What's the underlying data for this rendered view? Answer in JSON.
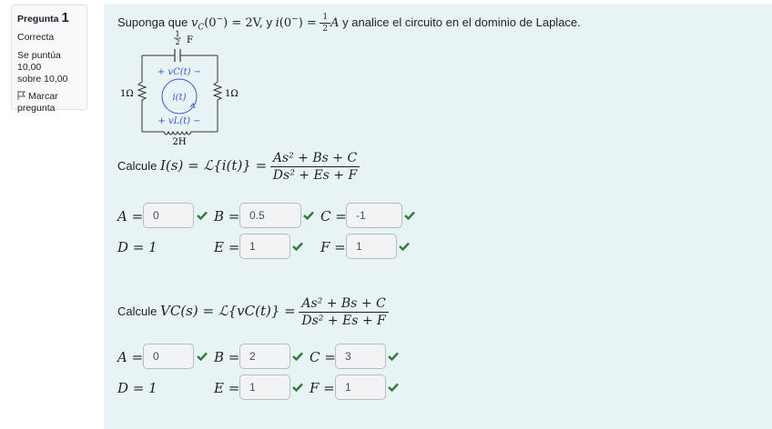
{
  "info": {
    "question_label": "Pregunta",
    "question_number": "1",
    "state": "Correcta",
    "score_line1": "Se puntúa 10,00",
    "score_line2": "sobre 10,00",
    "flag_line1": "Marcar",
    "flag_line2": "pregunta"
  },
  "question": {
    "intro_prefix": "Suponga que",
    "intro_vc": "v",
    "intro_vc_sub": "C",
    "intro_vc_arg": "(0",
    "intro_vc_sup": "−",
    "intro_vc_val": ") = 2V,",
    "intro_y": "y",
    "intro_i": "i",
    "intro_i_arg": "(0",
    "intro_i_sup": "−",
    "intro_i_eq": ") =",
    "intro_frac_num": "1",
    "intro_frac_den": "2",
    "intro_unit": "A",
    "intro_suffix": "y analice el circuito en el dominio de Laplace."
  },
  "circuit": {
    "cap_label_num": "1",
    "cap_label_den": "2",
    "cap_label_unit": "F",
    "r_left": "1Ω",
    "r_right": "1Ω",
    "vc_label": "+ vC(t) −",
    "it_label": "i(t)",
    "vl_label": "+ vL(t) −",
    "ind_label": "2H"
  },
  "part1": {
    "prefix": "Calcule",
    "lhs": "I(s) = ℒ{i(t)} =",
    "num": "As² + Bs + C",
    "den": "Ds² + Es + F",
    "labels": {
      "A": "A =",
      "B": "B =",
      "C": "C =",
      "D": "D = 1",
      "E": "E =",
      "F": "F ="
    },
    "values": {
      "A": "0",
      "B": "0.5",
      "C": "-1",
      "E": "1",
      "F": "1"
    }
  },
  "part2": {
    "prefix": "Calcule",
    "lhs": "VC(s) = ℒ{vC(t)} =",
    "num": "As² + Bs + C",
    "den": "Ds² + Es + F",
    "labels": {
      "A": "A =",
      "B": "B =",
      "C": "C =",
      "D": "D = 1",
      "E": "E =",
      "F": "F ="
    },
    "values": {
      "A": "0",
      "B": "2",
      "C": "3",
      "E": "1",
      "F": "1"
    }
  },
  "colors": {
    "correct": "#357a32",
    "circuit_blue": "#3a57c9",
    "panel_bg": "#e7f3f5"
  }
}
